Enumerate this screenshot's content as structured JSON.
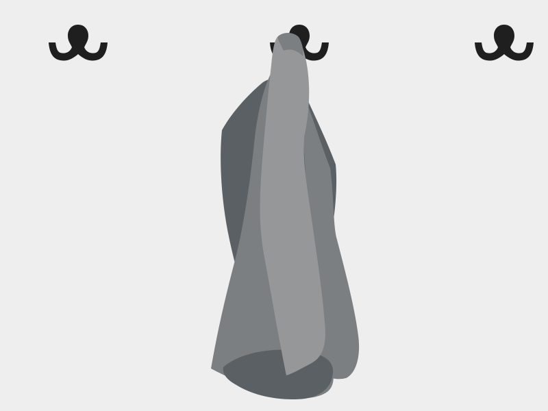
{
  "scene": {
    "wall": {
      "color": "#eeeeee"
    },
    "hooks": [
      {
        "name": "left",
        "icon": "double-coat-hook-icon",
        "color": "#1f1f1f"
      },
      {
        "name": "center",
        "icon": "double-coat-hook-icon",
        "color": "#1f1f1f"
      },
      {
        "name": "right",
        "icon": "double-coat-hook-icon",
        "color": "#1f1f1f"
      }
    ],
    "towel": {
      "icon": "hanging-towel-icon",
      "colors": {
        "shadow": "#5a6063",
        "mid": "#7b7f82",
        "highlight": "#959799"
      }
    }
  }
}
